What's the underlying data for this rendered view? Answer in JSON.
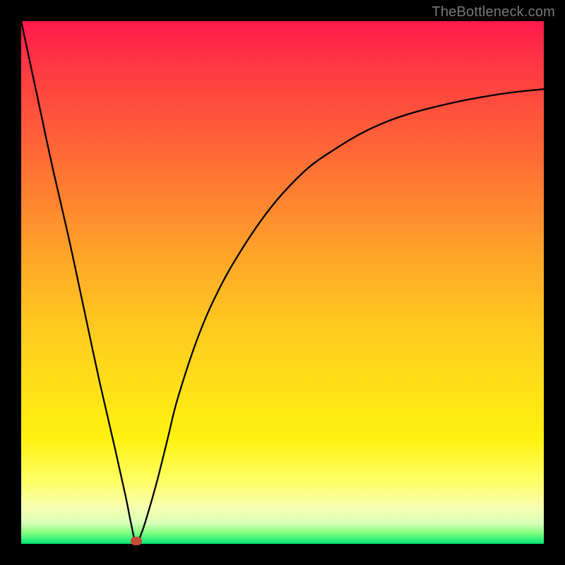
{
  "watermark": {
    "text": "TheBottleneck.com"
  },
  "colors": {
    "frame_bg": "#000000",
    "curve": "#000000",
    "marker": "#c94a3b",
    "gradient_stops": [
      "#ff1a4d",
      "#ff3344",
      "#ff5a3a",
      "#ff8030",
      "#ffa828",
      "#ffc820",
      "#ffe018",
      "#fff210",
      "#ffff66",
      "#f8ffb0",
      "#d8ffb8",
      "#7fff7f",
      "#00e676"
    ]
  },
  "chart_data": {
    "type": "line",
    "title": "",
    "xlabel": "",
    "ylabel": "",
    "xlim": [
      0,
      100
    ],
    "ylim": [
      0,
      100
    ],
    "grid": false,
    "legend": false,
    "description": "Bottleneck-percentage V-curve. Minimum near x≈22 at y≈0; left branch descends roughly linearly from top-left corner to the trough; right branch rises and saturates toward ~87 at the right edge.",
    "series": [
      {
        "name": "bottleneck_curve",
        "x": [
          0,
          3,
          6,
          9,
          12,
          15,
          18,
          20,
          21,
          22,
          23,
          24,
          26,
          28,
          30,
          34,
          38,
          42,
          46,
          50,
          55,
          60,
          65,
          70,
          75,
          80,
          85,
          90,
          95,
          100
        ],
        "y": [
          100,
          86,
          72,
          59,
          45,
          31,
          18,
          9,
          4,
          0,
          2,
          5,
          12,
          20,
          28,
          40,
          49,
          56,
          62,
          67,
          72,
          75.5,
          78.5,
          80.8,
          82.5,
          83.8,
          84.9,
          85.8,
          86.5,
          87
        ]
      }
    ],
    "marker": {
      "x": 22,
      "y": 0,
      "color": "#c94a3b",
      "shape": "rounded-rect"
    }
  }
}
